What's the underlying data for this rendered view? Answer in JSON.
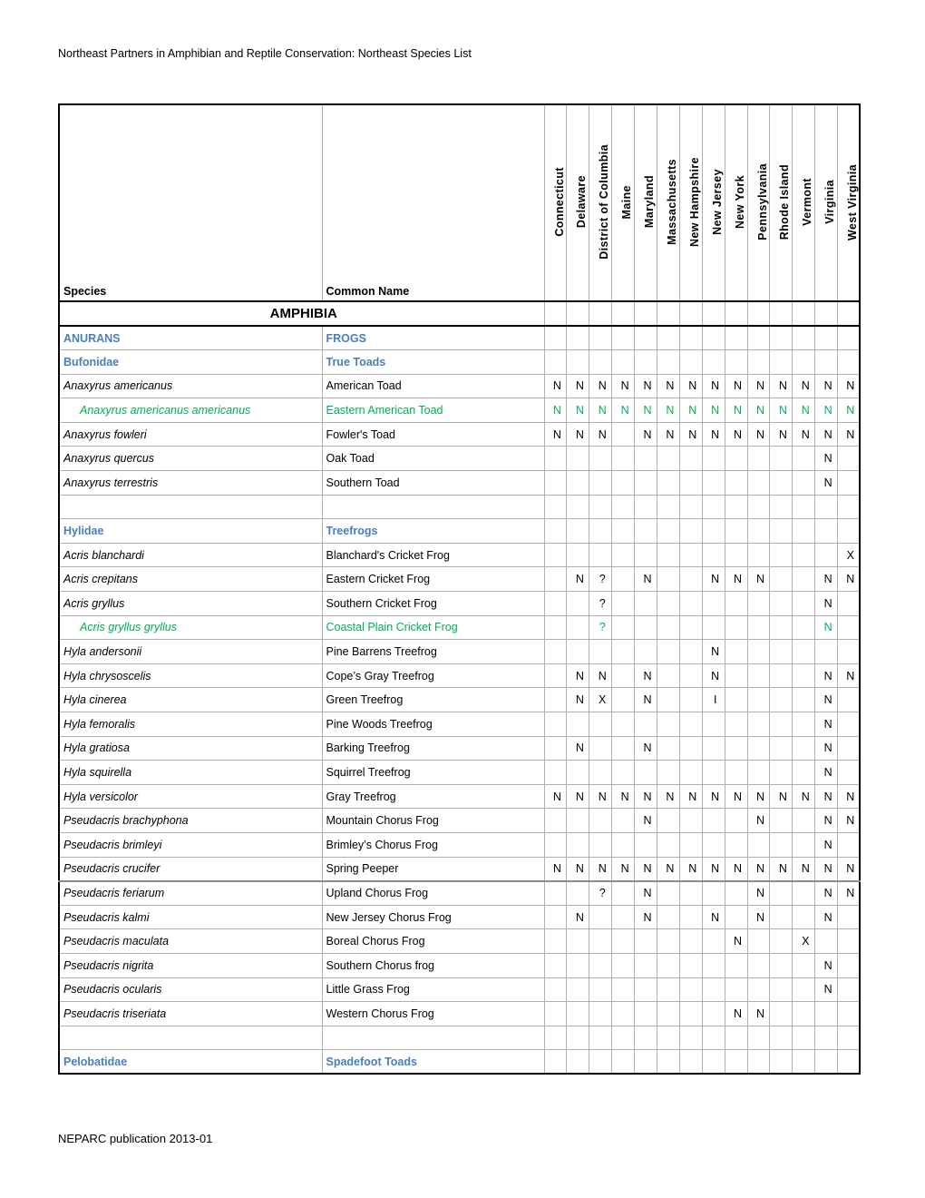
{
  "document": {
    "header": "Northeast Partners in Amphibian and Reptile Conservation: Northeast Species List",
    "footer": "NEPARC publication 2013-01"
  },
  "colors": {
    "blue": "#4a7ebb",
    "green": "#00b050",
    "text": "#000000",
    "grid": "#b0b0b0"
  },
  "table": {
    "col_species": "Species",
    "col_common": "Common Name",
    "states": [
      "Connecticut",
      "Delaware",
      "District of Columbia",
      "Maine",
      "Maryland",
      "Massachusetts",
      "New Hampshire",
      "New Jersey",
      "New York",
      "Pennsylvania",
      "Rhode Island",
      "Vermont",
      "Virginia",
      "West Virginia"
    ],
    "class_title": "AMPHIBIA",
    "rows": [
      {
        "type": "group",
        "style": "blue",
        "species": "ANURANS",
        "common": "FROGS",
        "cells": [
          "",
          "",
          "",
          "",
          "",
          "",
          "",
          "",
          "",
          "",
          "",
          "",
          "",
          ""
        ]
      },
      {
        "type": "family",
        "style": "blue",
        "species": "Bufonidae",
        "common": "True Toads",
        "cells": [
          "",
          "",
          "",
          "",
          "",
          "",
          "",
          "",
          "",
          "",
          "",
          "",
          "",
          ""
        ]
      },
      {
        "type": "species",
        "style": "normal",
        "species": "Anaxyrus americanus",
        "common": "American Toad",
        "cells": [
          "N",
          "N",
          "N",
          "N",
          "N",
          "N",
          "N",
          "N",
          "N",
          "N",
          "N",
          "N",
          "N",
          "N"
        ]
      },
      {
        "type": "subspecies",
        "style": "green",
        "species": "Anaxyrus americanus americanus",
        "common": "Eastern American Toad",
        "cells": [
          "N",
          "N",
          "N",
          "N",
          "N",
          "N",
          "N",
          "N",
          "N",
          "N",
          "N",
          "N",
          "N",
          "N"
        ]
      },
      {
        "type": "species",
        "style": "normal",
        "species": "Anaxyrus fowleri",
        "common": "Fowler's Toad",
        "cells": [
          "N",
          "N",
          "N",
          "",
          "N",
          "N",
          "N",
          "N",
          "N",
          "N",
          "N",
          "N",
          "N",
          "N"
        ]
      },
      {
        "type": "species",
        "style": "normal",
        "species": "Anaxyrus quercus",
        "common": "Oak Toad",
        "cells": [
          "",
          "",
          "",
          "",
          "",
          "",
          "",
          "",
          "",
          "",
          "",
          "",
          "N",
          ""
        ]
      },
      {
        "type": "species",
        "style": "normal",
        "species": "Anaxyrus terrestris",
        "common": "Southern Toad",
        "cells": [
          "",
          "",
          "",
          "",
          "",
          "",
          "",
          "",
          "",
          "",
          "",
          "",
          "N",
          ""
        ]
      },
      {
        "type": "blank",
        "style": "normal",
        "species": "",
        "common": "",
        "cells": [
          "",
          "",
          "",
          "",
          "",
          "",
          "",
          "",
          "",
          "",
          "",
          "",
          "",
          ""
        ]
      },
      {
        "type": "family",
        "style": "blue",
        "species": "Hylidae",
        "common": "Treefrogs",
        "cells": [
          "",
          "",
          "",
          "",
          "",
          "",
          "",
          "",
          "",
          "",
          "",
          "",
          "",
          ""
        ]
      },
      {
        "type": "species",
        "style": "normal",
        "species": "Acris blanchardi",
        "common": "Blanchard's Cricket Frog",
        "cells": [
          "",
          "",
          "",
          "",
          "",
          "",
          "",
          "",
          "",
          "",
          "",
          "",
          "",
          "X"
        ]
      },
      {
        "type": "species",
        "style": "normal",
        "species": "Acris crepitans",
        "common": "Eastern Cricket Frog",
        "cells": [
          "",
          "N",
          "?",
          "",
          "N",
          "",
          "",
          "N",
          "N",
          "N",
          "",
          "",
          "N",
          "N"
        ]
      },
      {
        "type": "species",
        "style": "normal",
        "species": "Acris gryllus",
        "common": "Southern Cricket Frog",
        "cells": [
          "",
          "",
          "?",
          "",
          "",
          "",
          "",
          "",
          "",
          "",
          "",
          "",
          "N",
          ""
        ]
      },
      {
        "type": "subspecies",
        "style": "green",
        "species": "Acris gryllus gryllus",
        "common": "Coastal Plain Cricket Frog",
        "cells": [
          "",
          "",
          "?",
          "",
          "",
          "",
          "",
          "",
          "",
          "",
          "",
          "",
          "N",
          ""
        ]
      },
      {
        "type": "species",
        "style": "normal",
        "species": "Hyla andersonii",
        "common": "Pine Barrens Treefrog",
        "cells": [
          "",
          "",
          "",
          "",
          "",
          "",
          "",
          "N",
          "",
          "",
          "",
          "",
          "",
          ""
        ]
      },
      {
        "type": "species",
        "style": "normal",
        "species": "Hyla chrysoscelis",
        "common": "Cope’s Gray Treefrog",
        "cells": [
          "",
          "N",
          "N",
          "",
          "N",
          "",
          "",
          "N",
          "",
          "",
          "",
          "",
          "N",
          "N"
        ]
      },
      {
        "type": "species",
        "style": "normal",
        "species": "Hyla cinerea",
        "common": "Green Treefrog",
        "cells": [
          "",
          "N",
          "X",
          "",
          "N",
          "",
          "",
          "I",
          "",
          "",
          "",
          "",
          "N",
          ""
        ]
      },
      {
        "type": "species",
        "style": "normal",
        "species": "Hyla femoralis",
        "common": "Pine Woods Treefrog",
        "cells": [
          "",
          "",
          "",
          "",
          "",
          "",
          "",
          "",
          "",
          "",
          "",
          "",
          "N",
          ""
        ]
      },
      {
        "type": "species",
        "style": "normal",
        "species": "Hyla gratiosa",
        "common": "Barking Treefrog",
        "cells": [
          "",
          "N",
          "",
          "",
          "N",
          "",
          "",
          "",
          "",
          "",
          "",
          "",
          "N",
          ""
        ]
      },
      {
        "type": "species",
        "style": "normal",
        "species": "Hyla squirella",
        "common": "Squirrel Treefrog",
        "cells": [
          "",
          "",
          "",
          "",
          "",
          "",
          "",
          "",
          "",
          "",
          "",
          "",
          "N",
          ""
        ]
      },
      {
        "type": "species",
        "style": "normal",
        "species": "Hyla versicolor",
        "common": "Gray Treefrog",
        "cells": [
          "N",
          "N",
          "N",
          "N",
          "N",
          "N",
          "N",
          "N",
          "N",
          "N",
          "N",
          "N",
          "N",
          "N"
        ]
      },
      {
        "type": "species",
        "style": "normal",
        "species": "Pseudacris brachyphona",
        "common": "Mountain Chorus Frog",
        "cells": [
          "",
          "",
          "",
          "",
          "N",
          "",
          "",
          "",
          "",
          "N",
          "",
          "",
          "N",
          "N"
        ]
      },
      {
        "type": "species",
        "style": "normal",
        "species": "Pseudacris brimleyi",
        "common": "Brimley’s Chorus Frog",
        "cells": [
          "",
          "",
          "",
          "",
          "",
          "",
          "",
          "",
          "",
          "",
          "",
          "",
          "N",
          ""
        ]
      },
      {
        "type": "species",
        "style": "normal",
        "species": "Pseudacris crucifer",
        "common": "Spring Peeper",
        "cells": [
          "N",
          "N",
          "N",
          "N",
          "N",
          "N",
          "N",
          "N",
          "N",
          "N",
          "N",
          "N",
          "N",
          "N"
        ]
      },
      {
        "type": "species",
        "style": "normal",
        "species": "Pseudacris feriarum",
        "common": "Upland Chorus Frog",
        "cells": [
          "",
          "",
          "?",
          "",
          "N",
          "",
          "",
          "",
          "",
          "N",
          "",
          "",
          "N",
          "N"
        ]
      },
      {
        "type": "species",
        "style": "normal",
        "species": "Pseudacris kalmi",
        "common": "New Jersey Chorus Frog",
        "cells": [
          "",
          "N",
          "",
          "",
          "N",
          "",
          "",
          "N",
          "",
          "N",
          "",
          "",
          "N",
          ""
        ]
      },
      {
        "type": "species",
        "style": "normal",
        "species": "Pseudacris maculata",
        "common": "Boreal Chorus Frog",
        "cells": [
          "",
          "",
          "",
          "",
          "",
          "",
          "",
          "",
          "N",
          "",
          "",
          "X",
          "",
          ""
        ]
      },
      {
        "type": "species",
        "style": "normal",
        "species": "Pseudacris nigrita",
        "common": "Southern Chorus frog",
        "cells": [
          "",
          "",
          "",
          "",
          "",
          "",
          "",
          "",
          "",
          "",
          "",
          "",
          "N",
          ""
        ]
      },
      {
        "type": "species",
        "style": "normal",
        "species": "Pseudacris ocularis",
        "common": "Little Grass Frog",
        "cells": [
          "",
          "",
          "",
          "",
          "",
          "",
          "",
          "",
          "",
          "",
          "",
          "",
          "N",
          ""
        ]
      },
      {
        "type": "species",
        "style": "normal",
        "species": "Pseudacris triseriata",
        "common": "Western Chorus Frog",
        "cells": [
          "",
          "",
          "",
          "",
          "",
          "",
          "",
          "",
          "N",
          "N",
          "",
          "",
          "",
          ""
        ]
      },
      {
        "type": "blank",
        "style": "normal",
        "species": "",
        "common": "",
        "cells": [
          "",
          "",
          "",
          "",
          "",
          "",
          "",
          "",
          "",
          "",
          "",
          "",
          "",
          ""
        ]
      },
      {
        "type": "family",
        "style": "blue",
        "species": "Pelobatidae",
        "common": "Spadefoot Toads",
        "cells": [
          "",
          "",
          "",
          "",
          "",
          "",
          "",
          "",
          "",
          "",
          "",
          "",
          "",
          ""
        ]
      }
    ]
  }
}
